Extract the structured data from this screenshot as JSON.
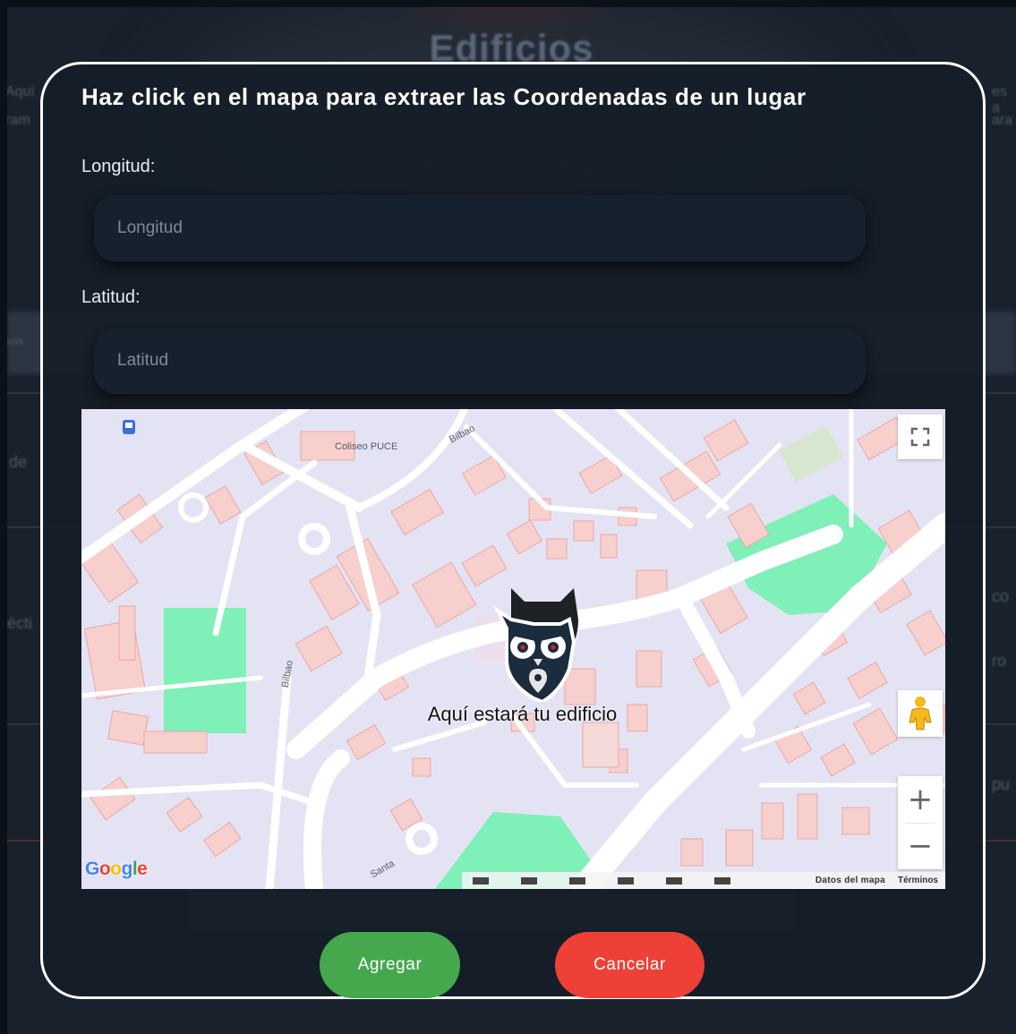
{
  "page": {
    "title": "Edificios",
    "left_snippets": [
      "Aquí",
      "ram",
      "tros",
      "de",
      "écti"
    ],
    "right_snippets": [
      "es a",
      "ara",
      "co",
      "ro",
      "pu"
    ]
  },
  "modal": {
    "title": "Haz click en el mapa para extraer las Coordenadas de un lugar",
    "longitude": {
      "label": "Longitud:",
      "placeholder": "Longitud",
      "value": ""
    },
    "latitude": {
      "label": "Latitud:",
      "placeholder": "Latitud",
      "value": ""
    },
    "map": {
      "place_labels": [
        "Coliseo PUCE",
        "Bilbao",
        "Bilbao",
        "Santa"
      ],
      "marker_text": "Aquí estará tu edificio",
      "google_logo": "Google",
      "attribution_data": "Datos del mapa",
      "attribution_terms": "Términos",
      "zoom_in": "+",
      "zoom_out": "−",
      "colors": {
        "land": "#e4e3f4",
        "building": "#f7cfcc",
        "road": "#ffffff",
        "park": "#7ff0b7"
      }
    },
    "buttons": {
      "add": "Agregar",
      "cancel": "Cancelar"
    }
  },
  "colors": {
    "modal_bg": "#141d28",
    "add": "#45a84d",
    "cancel": "#ee4036"
  }
}
